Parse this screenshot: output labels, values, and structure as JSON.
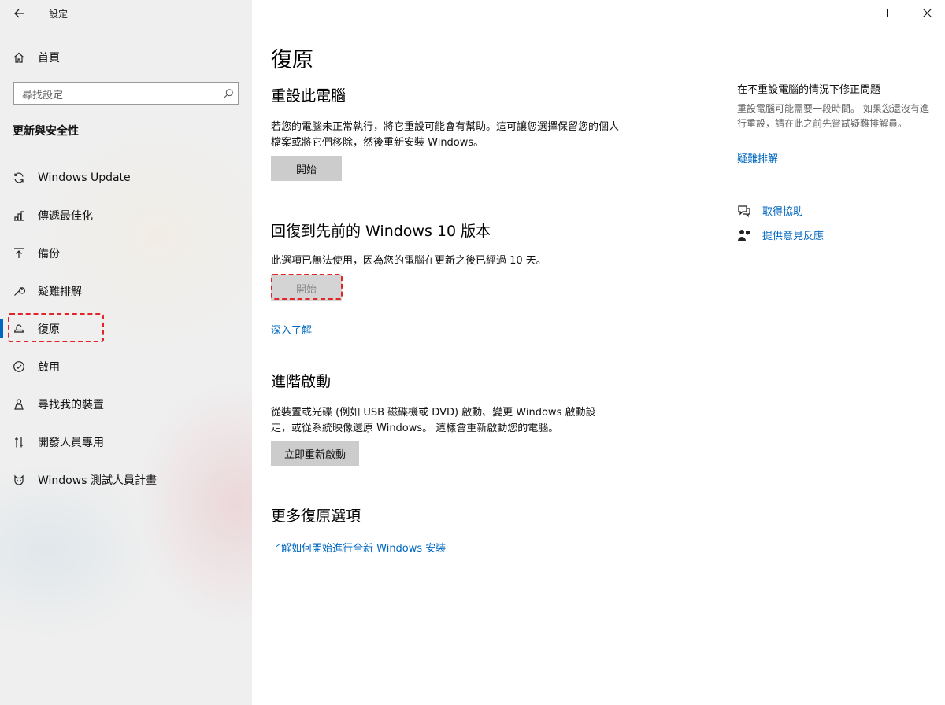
{
  "app": {
    "title": "設定"
  },
  "sidebar": {
    "home_label": "首頁",
    "search_placeholder": "尋找設定",
    "section_label": "更新與安全性",
    "items": [
      {
        "label": "Windows Update",
        "icon": "sync-icon"
      },
      {
        "label": "傳遞最佳化",
        "icon": "delivery-optimization-icon"
      },
      {
        "label": "備份",
        "icon": "backup-icon"
      },
      {
        "label": "疑難排解",
        "icon": "wrench-icon"
      },
      {
        "label": "復原",
        "icon": "recovery-icon",
        "selected": true
      },
      {
        "label": "啟用",
        "icon": "check-circle-icon"
      },
      {
        "label": "尋找我的裝置",
        "icon": "find-device-icon"
      },
      {
        "label": "開發人員專用",
        "icon": "developer-icon"
      },
      {
        "label": "Windows 測試人員計畫",
        "icon": "insider-icon"
      }
    ]
  },
  "main": {
    "title": "復原",
    "reset": {
      "heading": "重設此電腦",
      "description": "若您的電腦未正常執行，將它重設可能會有幫助。這可讓您選擇保留您的個人檔案或將它們移除，然後重新安裝 Windows。",
      "button": "開始"
    },
    "goback": {
      "heading": "回復到先前的 Windows 10 版本",
      "description": "此選項已無法使用，因為您的電腦在更新之後已經過 10 天。",
      "button": "開始",
      "link": "深入了解"
    },
    "advanced": {
      "heading": "進階啟動",
      "description": "從裝置或光碟 (例如 USB 磁碟機或 DVD) 啟動、變更 Windows 啟動設定，或從系統映像還原 Windows。 這樣會重新啟動您的電腦。",
      "button": "立即重新啟動"
    },
    "more": {
      "heading": "更多復原選項",
      "link": "了解如何開始進行全新 Windows 安裝"
    }
  },
  "right": {
    "title": "在不重設電腦的情況下修正問題",
    "description": "重設電腦可能需要一段時間。 如果您還沒有進行重設，請在此之前先嘗試疑難排解員。",
    "troubleshoot_link": "疑難排解",
    "help_link": "取得協助",
    "feedback_link": "提供意見反應"
  },
  "colors": {
    "accent": "#0067c0",
    "highlight": "#e0262b"
  }
}
